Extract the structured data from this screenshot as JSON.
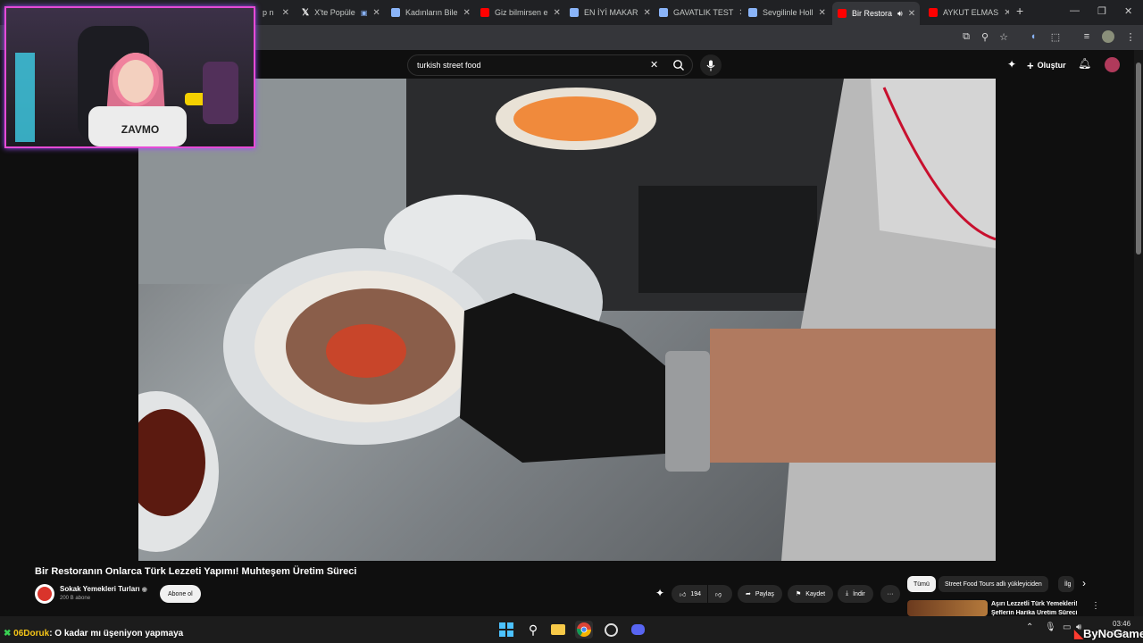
{
  "browser": {
    "tabs": [
      {
        "label": "p n",
        "favicon_color": "#c4c7c5"
      },
      {
        "label": "X'te Popüle",
        "favicon_color": "#ffffff"
      },
      {
        "label": "Kadınların Bile",
        "favicon_color": "#8ab4f8"
      },
      {
        "label": "Giz bilmirsen e",
        "favicon_color": "#ff0000"
      },
      {
        "label": "EN İYİ MAKAR",
        "favicon_color": "#8ab4f8"
      },
      {
        "label": "GAVATLIK TEST",
        "favicon_color": "#8ab4f8"
      },
      {
        "label": "Sevgilinle Holl",
        "favicon_color": "#8ab4f8"
      },
      {
        "label": "Bir Restora",
        "favicon_color": "#ff0000",
        "active": true
      },
      {
        "label": "AYKUT ELMAS",
        "favicon_color": "#ff0000"
      }
    ],
    "new_tab_label": "+",
    "window_controls": [
      "—",
      "❐",
      "✕"
    ]
  },
  "youtube": {
    "search": {
      "value": "turkish street food"
    },
    "create_label": "Oluştur",
    "video": {
      "title": "Bir Restoranın Onlarca Türk Lezzeti Yapımı! Muhteşem Üretim Süreci",
      "channel_name": "Sokak Yemekleri Turları",
      "subscribers": "200 B abone",
      "subscribe_label": "Abone ol",
      "likes": "194",
      "share_label": "Paylaş",
      "save_label": "Kaydet",
      "download_label": "İndir",
      "more_label": "···"
    },
    "chips": [
      "Tümü",
      "Street Food Tours adlı yükleyiciden",
      "İlg"
    ],
    "related": {
      "title_line1": "Aşırı Lezzetli Türk Yemekleri!",
      "title_line2": "Şeflerin Harika Üretim Süreci"
    },
    "webcam_caption": "ZAVMO"
  },
  "stream_chat": {
    "username": "06Doruk",
    "message": ": O kadar mı üşeniyon yapmaya"
  },
  "taskbar": {
    "time": "03:46",
    "date": "17.11.2024",
    "watermark": "ByNoGame"
  },
  "colors": {
    "youtube_red": "#ff0000",
    "overlay_border": "#e64bd6",
    "chat_username": "#f5c518"
  }
}
